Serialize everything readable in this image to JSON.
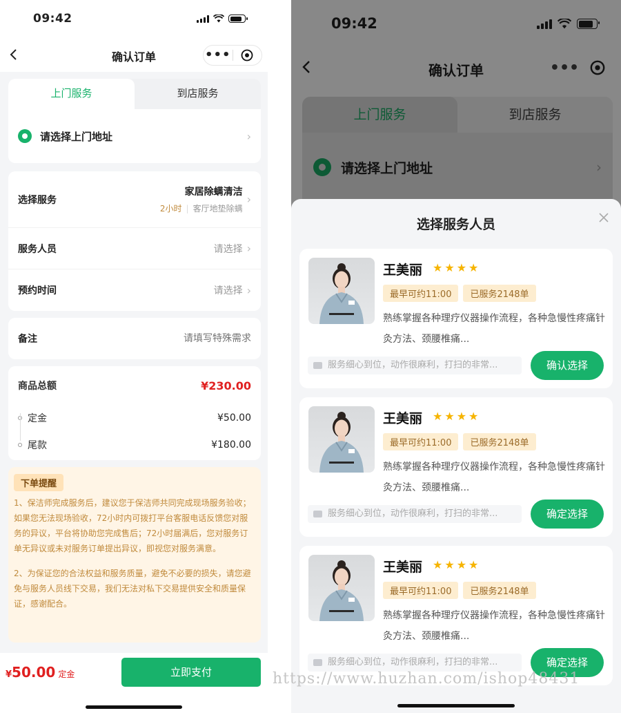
{
  "status": {
    "time": "09:42"
  },
  "nav": {
    "title": "确认订单",
    "more": "•••"
  },
  "tabs": [
    {
      "label": "上门服务",
      "active": true
    },
    {
      "label": "到店服务",
      "active": false
    }
  ],
  "address": {
    "label": "请选择上门地址"
  },
  "service": {
    "label": "选择服务",
    "name": "家居除螨清洁",
    "duration": "2小时",
    "detail": "客厅地垫除螨"
  },
  "staff": {
    "label": "服务人员",
    "value": "请选择"
  },
  "appointment": {
    "label": "预约时间",
    "value": "请选择"
  },
  "remark": {
    "label": "备注",
    "placeholder": "请填写特殊需求"
  },
  "pricing": {
    "total_label": "商品总额",
    "total": "¥230.00",
    "deposit_label": "定金",
    "deposit": "¥50.00",
    "balance_label": "尾款",
    "balance": "¥180.00"
  },
  "notice": {
    "title": "下单提醒",
    "p1": "1、保洁师完成服务后，建议您于保洁师共同完成现场服务验收；如果您无法现场验收，72小时内可拨打平台客服电话反馈您对服务的异议，平台将协助您完成售后；72小时届满后，您对服务订单无异议或未对服务订单提出异议，即视您对服务满意。",
    "p2": "2、为保证您的合法权益和服务质量，避免不必要的损失，请您避免与服务人员线下交易，我们无法对私下交易提供安全和质量保证，感谢配合。"
  },
  "footer": {
    "currency": "¥",
    "amount": "50.00",
    "amount_label": "定金",
    "pay_button": "立即支付"
  },
  "sheet": {
    "title": "选择服务人员",
    "staff": [
      {
        "name": "王美丽",
        "stars": "★★★★",
        "earliest": "最早可约11:00",
        "served": "已服务2148单",
        "desc": "熟练掌握各种理疗仪器操作流程，各种急慢性疼痛针灸方法、颈腰椎痛...",
        "review": "服务细心到位，动作很麻利，打扫的非常...",
        "button": "确认选择"
      },
      {
        "name": "王美丽",
        "stars": "★★★★",
        "earliest": "最早可约11:00",
        "served": "已服务2148单",
        "desc": "熟练掌握各种理疗仪器操作流程，各种急慢性疼痛针灸方法、颈腰椎痛...",
        "review": "服务细心到位，动作很麻利，打扫的非常...",
        "button": "确定选择"
      },
      {
        "name": "王美丽",
        "stars": "★★★★",
        "earliest": "最早可约11:00",
        "served": "已服务2148单",
        "desc": "熟练掌握各种理疗仪器操作流程，各种急慢性疼痛针灸方法、颈腰椎痛...",
        "review": "服务细心到位，动作很麻利，打扫的非常...",
        "button": "确定选择"
      }
    ]
  },
  "watermark": "https://www.huzhan.com/ishop48431",
  "colors": {
    "accent": "#18b26b",
    "price": "#e02020",
    "notice_bg": "#fff5e6",
    "tag_bg": "#fdedd0"
  }
}
